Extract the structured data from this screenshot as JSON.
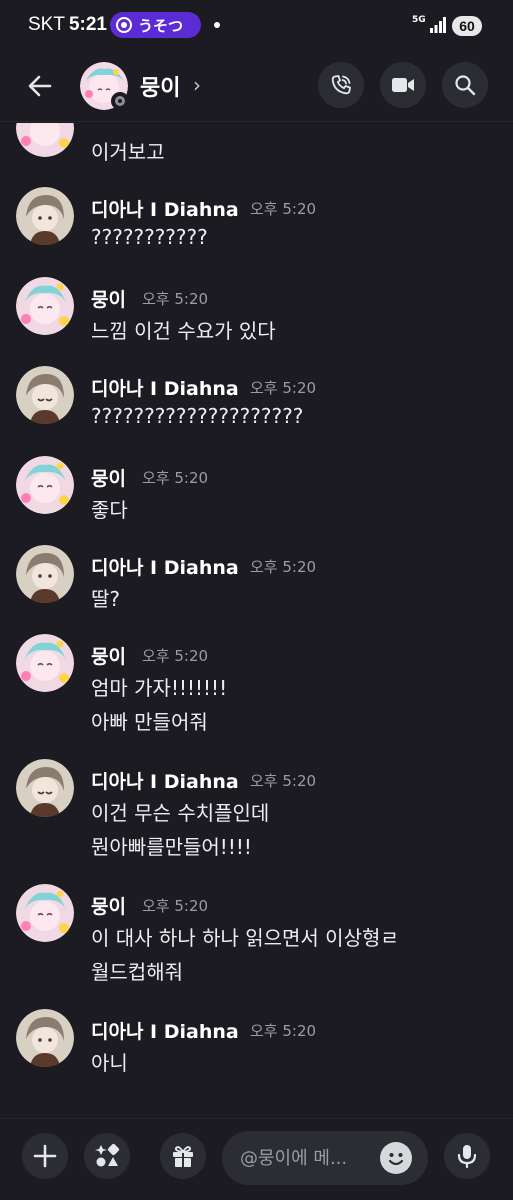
{
  "status_bar": {
    "carrier": "SKT",
    "time": "5:21",
    "live_label": "うそつ",
    "network": "5G",
    "battery": "60"
  },
  "header": {
    "channel_name": "뭉이",
    "chevron": "›",
    "icons": [
      "back-arrow-icon",
      "phone-call-icon",
      "video-camera-icon",
      "search-icon"
    ]
  },
  "users": {
    "mung": {
      "name": "뭉이"
    },
    "diahna": {
      "name": "디아나 I Diahna"
    }
  },
  "messages": [
    {
      "author": "",
      "time": "",
      "lines": [
        "이거보고"
      ]
    },
    {
      "author": "디아나 I Diahna",
      "time": "오후 5:20",
      "lines": [
        "???????????"
      ]
    },
    {
      "author": "뭉이",
      "time": "오후 5:20",
      "lines": [
        "느낌 이건 수요가 있다"
      ]
    },
    {
      "author": "디아나 I Diahna",
      "time": "오후 5:20",
      "lines": [
        "????????????????????"
      ]
    },
    {
      "author": "뭉이",
      "time": "오후 5:20",
      "lines": [
        "좋다"
      ]
    },
    {
      "author": "디아나 I Diahna",
      "time": "오후 5:20",
      "lines": [
        "딸?"
      ]
    },
    {
      "author": "뭉이",
      "time": "오후 5:20",
      "lines": [
        "엄마 가자!!!!!!!",
        "아빠 만들어줘"
      ]
    },
    {
      "author": "디아나 I Diahna",
      "time": "오후 5:20",
      "lines": [
        "이건 무슨 수치플인데",
        "뭔아빠를만들어!!!!"
      ]
    },
    {
      "author": "뭉이",
      "time": "오후 5:20",
      "lines": [
        "이 대사 하나 하나 읽으면서 이상형ㄹ",
        "월드컵해줘"
      ]
    },
    {
      "author": "디아나 I Diahna",
      "time": "오후 5:20",
      "lines": [
        "아니"
      ]
    }
  ],
  "composer": {
    "placeholder": "@뭉이에 메...",
    "icons": [
      "plus-icon",
      "apps-icon",
      "gift-icon",
      "emoji-icon",
      "microphone-icon"
    ]
  },
  "colors": {
    "background": "#1b1b21",
    "button_bg": "#2c2d33",
    "live_pill": "#5b2bd6",
    "text_primary": "#f2f3f5",
    "text_muted": "#9b9ca4"
  }
}
